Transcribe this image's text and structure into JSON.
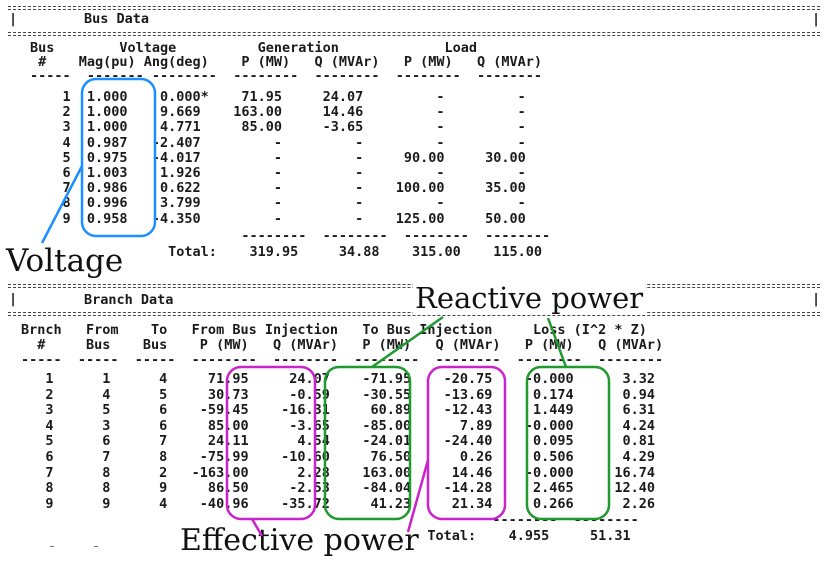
{
  "bus_section": {
    "title": "Bus Data",
    "header_line1": "Bus        Voltage          Generation             Load",
    "header_line2": " #    Mag(pu) Ang(deg)    P (MW)   Q (MVAr)   P (MW)   Q (MVAr)",
    "header_dash": "-----  ------- --------  --------  --------  --------  --------",
    "rows": [
      "    1  1.000    0.000*    71.95     24.07         -         -",
      "    2  1.000    9.669    163.00     14.46         -         -",
      "    3  1.000    4.771     85.00     -3.65         -         -",
      "    4  0.987   -2.407         -         -         -         -",
      "    5  0.975   -4.017         -         -     90.00     30.00",
      "    6  1.003    1.926         -         -         -         -",
      "    7  0.986    0.622         -         -    100.00     35.00",
      "    8  0.996    3.799         -         -         -         -",
      "    9  0.958   -4.350         -         -    125.00     50.00"
    ],
    "total_dash": "                          --------  --------  --------  --------",
    "total_line": "                 Total:    319.95     34.88    315.00    115.00"
  },
  "branch_section": {
    "title": "Branch Data",
    "header_line1": "Brnch   From    To   From Bus Injection   To Bus Injection     Loss (I^2 * Z)",
    "header_line2": "  #     Bus    Bus    P (MW)   Q (MVAr)   P (MW)   Q (MVAr)   P (MW)   Q (MVAr)",
    "header_dash": "-----  -----  -----  --------  --------  --------  --------  --------  --------",
    "rows": [
      "   1      1      4     71.95     24.07    -71.95    -20.75    -0.000      3.32",
      "   2      4      5     30.73     -0.59    -30.55    -13.69     0.174      0.94",
      "   3      5      6    -59.45    -16.31     60.89    -12.43     1.449      6.31",
      "   4      3      6     85.00     -3.65    -85.00      7.89    -0.000      4.24",
      "   5      6      7     24.11      4.54    -24.01    -24.40     0.095      0.81",
      "   6      7      8    -75.99    -10.60     76.50      0.26     0.506      4.29",
      "   7      8      2   -163.00      2.28    163.00     14.46    -0.000     16.74",
      "   8      8      9     86.50     -2.53    -84.04    -14.28     2.465     12.40",
      "   9      9      4    -40.96    -35.72     41.23     21.34     0.266      2.26"
    ],
    "total_dash": "                                                          --------  --------",
    "total_line": "                                                  Total:    4.955     51.31"
  },
  "annotations": {
    "voltage": "Voltage",
    "reactive_power": "Reactive power",
    "effective_power": "Effective power"
  },
  "marks": {
    "pipe": "|",
    "stray_dash": "-"
  },
  "colors": {
    "voltage_box": "#1e8fff",
    "effective_box": "#cc22cc",
    "reactive_box": "#1f9a2f"
  }
}
